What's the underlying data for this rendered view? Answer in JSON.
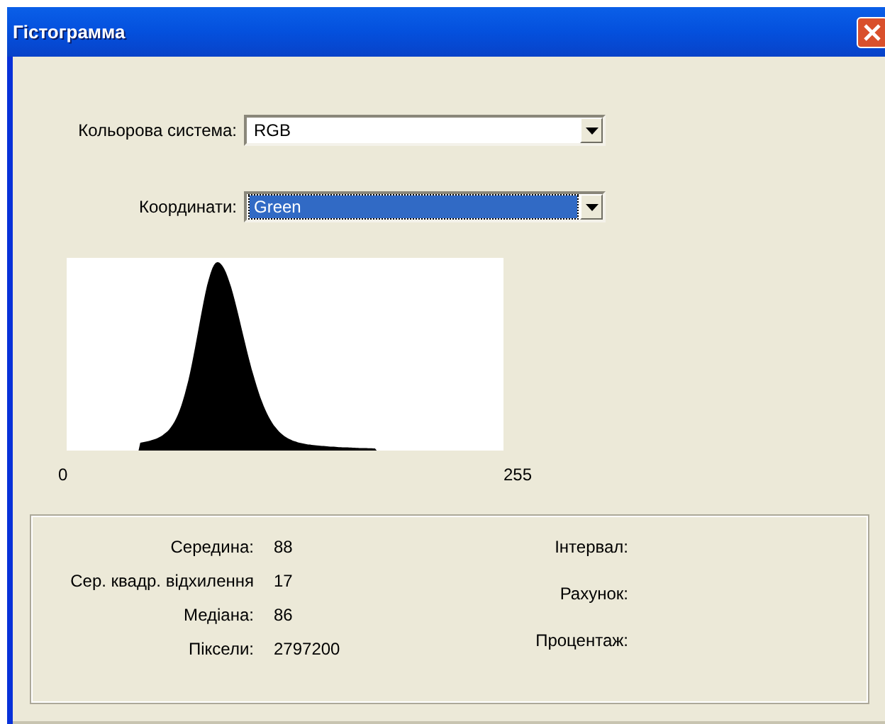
{
  "window": {
    "title": "Гістограмма"
  },
  "fields": [
    {
      "label": "Кольорова система:",
      "value": "RGB",
      "selected": false
    },
    {
      "label": "Координати:",
      "value": "Green",
      "selected": true
    }
  ],
  "histogram": {
    "min_label": "0",
    "max_label": "255"
  },
  "stats": [
    {
      "label": "Середина:",
      "value": "88"
    },
    {
      "label": "Сер. квадр. відхилення",
      "value": "17"
    },
    {
      "label": "Медіана:",
      "value": "86"
    },
    {
      "label": "Піксели:",
      "value": "2797200"
    }
  ],
  "stats_right": [
    {
      "label": "Інтервал:"
    },
    {
      "label": "Рахунок:"
    },
    {
      "label": "Процентаж:"
    }
  ]
}
